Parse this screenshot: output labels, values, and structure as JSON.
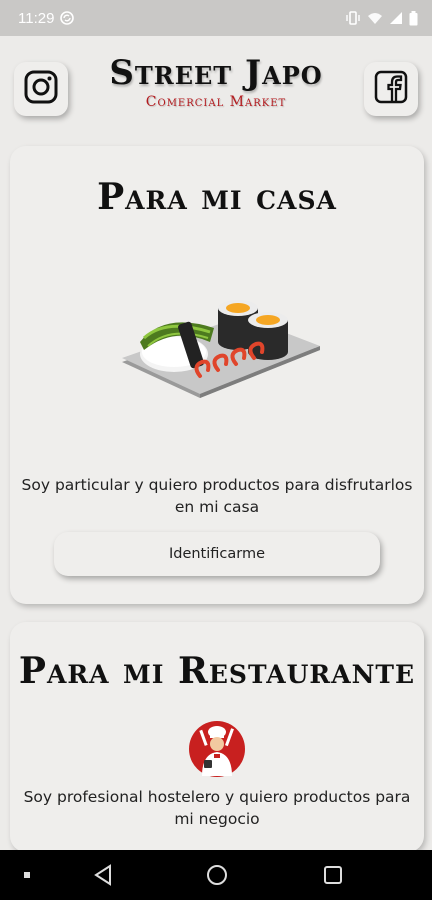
{
  "status_bar": {
    "time": "11:29",
    "icons": [
      "sync-icon",
      "vibrate-icon",
      "wifi-icon",
      "signal-icon",
      "battery-icon"
    ]
  },
  "header": {
    "title": "Street Japo",
    "subtitle": "Comercial Market",
    "icons": [
      "instagram-icon",
      "facebook-icon"
    ]
  },
  "cards": [
    {
      "title": "Para mi casa",
      "description": "Soy particular y quiero productos para disfrutarlos en mi casa",
      "button_label": "Identificarme",
      "illustration": "sushi-plate-illustration"
    },
    {
      "title": "Para mi Restaurante",
      "description": "Soy profesional hostelero y quiero productos para mi negocio",
      "illustration": "chef-illustration"
    }
  ],
  "nav_bar": {
    "icons": [
      "menu-dot-icon",
      "back-icon",
      "home-icon",
      "recents-icon"
    ]
  },
  "colors": {
    "background": "#ecebe9",
    "card": "#efeeec",
    "brand_red": "#b3191d",
    "status_bar": "#c9c8c6",
    "nav_bar": "#000000"
  }
}
